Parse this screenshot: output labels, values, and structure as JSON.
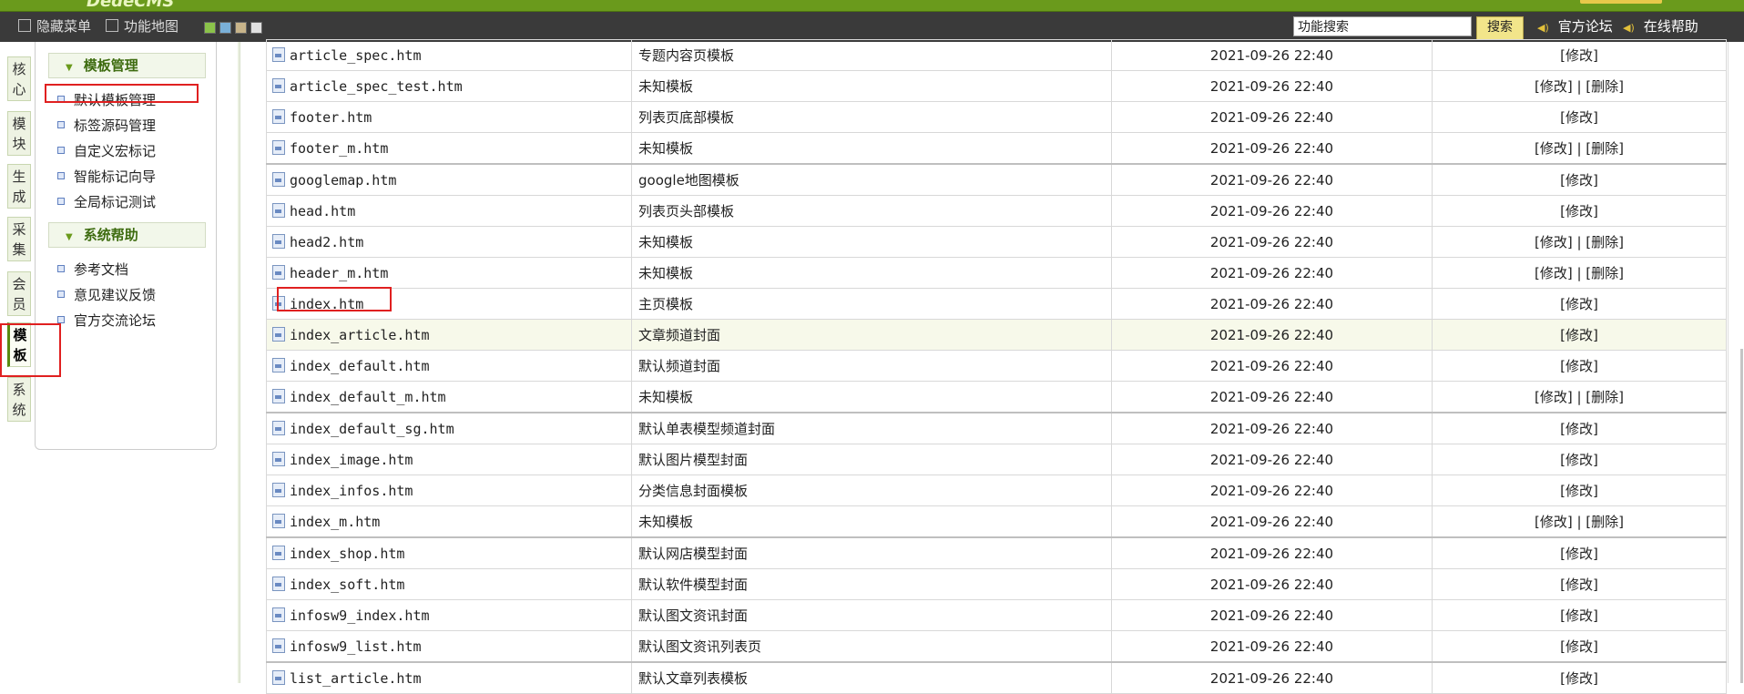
{
  "header": {
    "logo_text": "DedeCMS",
    "hide_menu": "隐藏菜单",
    "function_map": "功能地图",
    "search_value": "功能搜索",
    "search_button": "搜索",
    "forum_link": "官方论坛",
    "help_link": "在线帮助",
    "skin_colors": [
      "#8bc34a",
      "#7ab0d8",
      "#c8b48a",
      "#e0e0e0"
    ]
  },
  "side_tabs": [
    {
      "label": "核心",
      "active": false
    },
    {
      "label": "模块",
      "active": false
    },
    {
      "label": "生成",
      "active": false
    },
    {
      "label": "采集",
      "active": false
    },
    {
      "label": "会员",
      "active": false
    },
    {
      "label": "模板",
      "active": true
    },
    {
      "label": "系统",
      "active": false
    }
  ],
  "menu": {
    "group1_title": "模板管理",
    "group1_items": [
      "默认模板管理",
      "标签源码管理",
      "自定义宏标记",
      "智能标记向导",
      "全局标记测试"
    ],
    "group2_title": "系统帮助",
    "group2_items": [
      "参考文档",
      "意见建议反馈",
      "官方交流论坛"
    ]
  },
  "ops": {
    "edit": "[修改]",
    "sep": " | ",
    "delete": "[删除]"
  },
  "files": [
    {
      "name": "article_spec.htm",
      "desc": "专题内容页模板",
      "time": "2021-09-26 22:40",
      "deletable": false
    },
    {
      "name": "article_spec_test.htm",
      "desc": "未知模板",
      "time": "2021-09-26 22:40",
      "deletable": true
    },
    {
      "name": "footer.htm",
      "desc": "列表页底部模板",
      "time": "2021-09-26 22:40",
      "deletable": false
    },
    {
      "name": "footer_m.htm",
      "desc": "未知模板",
      "time": "2021-09-26 22:40",
      "deletable": true
    },
    {
      "name": "googlemap.htm",
      "desc": "google地图模板",
      "time": "2021-09-26 22:40",
      "deletable": false
    },
    {
      "name": "head.htm",
      "desc": "列表页头部模板",
      "time": "2021-09-26 22:40",
      "deletable": false
    },
    {
      "name": "head2.htm",
      "desc": "未知模板",
      "time": "2021-09-26 22:40",
      "deletable": true
    },
    {
      "name": "header_m.htm",
      "desc": "未知模板",
      "time": "2021-09-26 22:40",
      "deletable": true
    },
    {
      "name": "index.htm",
      "desc": "主页模板",
      "time": "2021-09-26 22:40",
      "deletable": false
    },
    {
      "name": "index_article.htm",
      "desc": "文章频道封面",
      "time": "2021-09-26 22:40",
      "deletable": false
    },
    {
      "name": "index_default.htm",
      "desc": "默认频道封面",
      "time": "2021-09-26 22:40",
      "deletable": false
    },
    {
      "name": "index_default_m.htm",
      "desc": "未知模板",
      "time": "2021-09-26 22:40",
      "deletable": true
    },
    {
      "name": "index_default_sg.htm",
      "desc": "默认单表模型频道封面",
      "time": "2021-09-26 22:40",
      "deletable": false
    },
    {
      "name": "index_image.htm",
      "desc": "默认图片模型封面",
      "time": "2021-09-26 22:40",
      "deletable": false
    },
    {
      "name": "index_infos.htm",
      "desc": "分类信息封面模板",
      "time": "2021-09-26 22:40",
      "deletable": false
    },
    {
      "name": "index_m.htm",
      "desc": "未知模板",
      "time": "2021-09-26 22:40",
      "deletable": true
    },
    {
      "name": "index_shop.htm",
      "desc": "默认网店模型封面",
      "time": "2021-09-26 22:40",
      "deletable": false
    },
    {
      "name": "index_soft.htm",
      "desc": "默认软件模型封面",
      "time": "2021-09-26 22:40",
      "deletable": false
    },
    {
      "name": "infosw9_index.htm",
      "desc": "默认图文资讯封面",
      "time": "2021-09-26 22:40",
      "deletable": false
    },
    {
      "name": "infosw9_list.htm",
      "desc": "默认图文资讯列表页",
      "time": "2021-09-26 22:40",
      "deletable": false
    },
    {
      "name": "list_article.htm",
      "desc": "默认文章列表模板",
      "time": "2021-09-26 22:40",
      "deletable": false
    }
  ]
}
